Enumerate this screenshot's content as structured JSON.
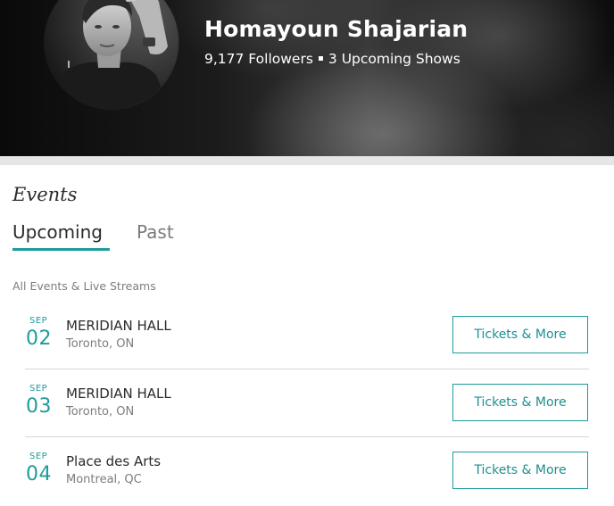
{
  "artist": {
    "name": "Homayoun Shajarian",
    "followers": "9,177 Followers",
    "upcoming_shows": "3 Upcoming Shows"
  },
  "events": {
    "heading": "Events",
    "tabs": [
      {
        "label": "Upcoming",
        "active": true
      },
      {
        "label": "Past",
        "active": false
      }
    ],
    "filter_label": "All Events & Live Streams",
    "items": [
      {
        "month": "SEP",
        "day": "02",
        "venue": "MERIDIAN HALL",
        "city": "Toronto, ON",
        "button": "Tickets & More"
      },
      {
        "month": "SEP",
        "day": "03",
        "venue": "MERIDIAN HALL",
        "city": "Toronto, ON",
        "button": "Tickets & More"
      },
      {
        "month": "SEP",
        "day": "04",
        "venue": "Place des Arts",
        "city": "Montreal, QC",
        "button": "Tickets & More"
      }
    ]
  },
  "colors": {
    "accent": "#1f9b9b",
    "text_primary": "#2b2b2b",
    "text_muted": "#7d7d7d",
    "divider": "#d6d6d6"
  },
  "icons": {
    "separator": "square-dot-icon"
  }
}
